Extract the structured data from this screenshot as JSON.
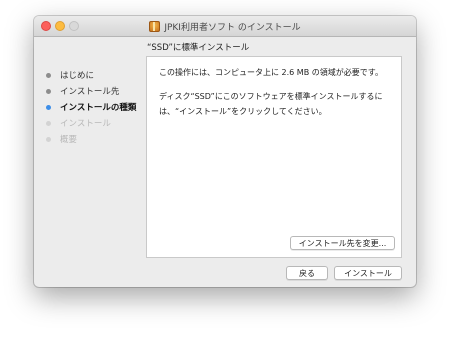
{
  "window": {
    "title": "JPKI利用者ソフト のインストール",
    "icon": "package-icon"
  },
  "section_header": "“SSD”に標準インストール",
  "steps": [
    {
      "label": "はじめに",
      "state": "done"
    },
    {
      "label": "インストール先",
      "state": "done"
    },
    {
      "label": "インストールの種類",
      "state": "current"
    },
    {
      "label": "インストール",
      "state": "todo"
    },
    {
      "label": "概要",
      "state": "todo"
    }
  ],
  "content": {
    "paragraph1": "この操作には、コンピュータ上に 2.6 MB の領域が必要です。",
    "paragraph2": "ディスク“SSD”にこのソフトウェアを標準インストールするには、“インストール”をクリックしてください。",
    "change_location_button": "インストール先を変更..."
  },
  "footer": {
    "back_button": "戻る",
    "install_button": "インストール"
  },
  "colors": {
    "current_step_dot": "#3d8ee8",
    "close": "#fc605c",
    "minimize": "#fdbc40"
  }
}
